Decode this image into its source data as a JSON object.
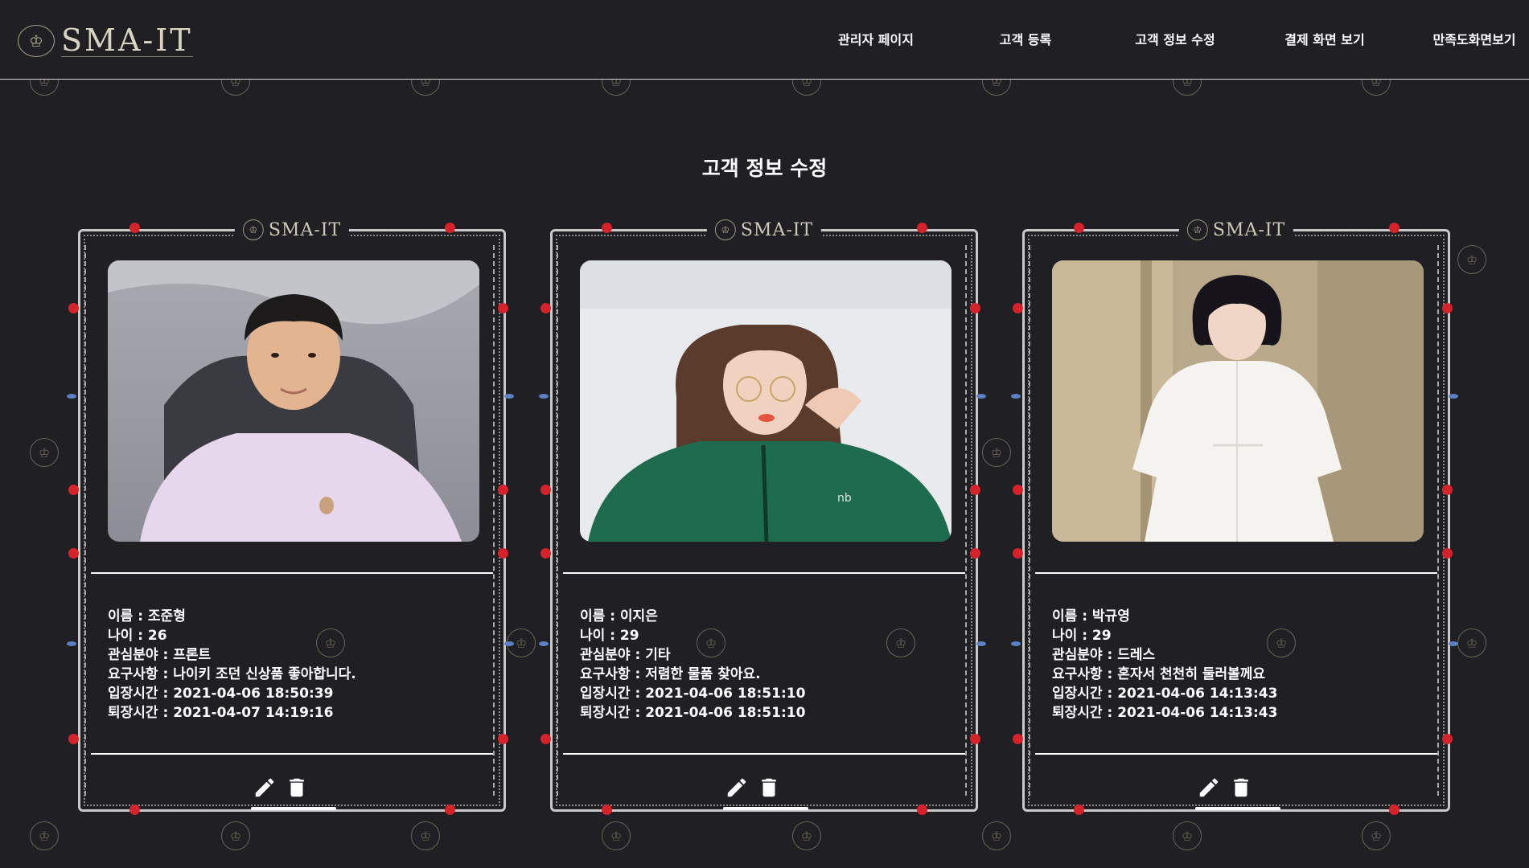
{
  "header": {
    "logo_text": "SMA-IT",
    "nav": [
      "관리자 페이지",
      "고객 등록",
      "고객 정보 수정",
      "결제 화면 보기",
      "만족도화면보기"
    ]
  },
  "page_title": "고객 정보 수정",
  "frame_logo_text": "SMA-IT",
  "customers": [
    {
      "photo": "photo of young man in lavender sweatshirt",
      "name": "이름 : 조준형",
      "age": "나이 : 26",
      "interest": "관심분야 : 프론트",
      "request": "요구사항 : 나이키 조던 신상품 좋아합니다.",
      "entry": "입장시간 : 2021-04-06 18:50:39",
      "exit": "퇴장시간 : 2021-04-07 14:19:16"
    },
    {
      "photo": "photo of woman in green jacket with glasses",
      "name": "이름 : 이지은",
      "age": "나이 : 29",
      "interest": "관심분야 : 기타",
      "request": "요구사항 : 저렴한 물품 찾아요.",
      "entry": "입장시간 : 2021-04-06 18:51:10",
      "exit": "퇴장시간 : 2021-04-06 18:51:10"
    },
    {
      "photo": "photo of woman in white dress",
      "name": "이름 : 박규영",
      "age": "나이 : 29",
      "interest": "관심분야 : 드레스",
      "request": "요구사항 : 혼자서 천천히 둘러볼께요",
      "entry": "입장시간 : 2021-04-06 14:13:43",
      "exit": "퇴장시간 : 2021-04-06 14:13:43"
    }
  ],
  "icons": {
    "edit": "pencil-icon",
    "delete": "trash-icon"
  },
  "colors": {
    "background": "#1f1f24",
    "text": "#ffffff",
    "accent_red": "#d4232b",
    "accent_blue": "#5c80c4",
    "crown_gold": "#6b6452"
  }
}
